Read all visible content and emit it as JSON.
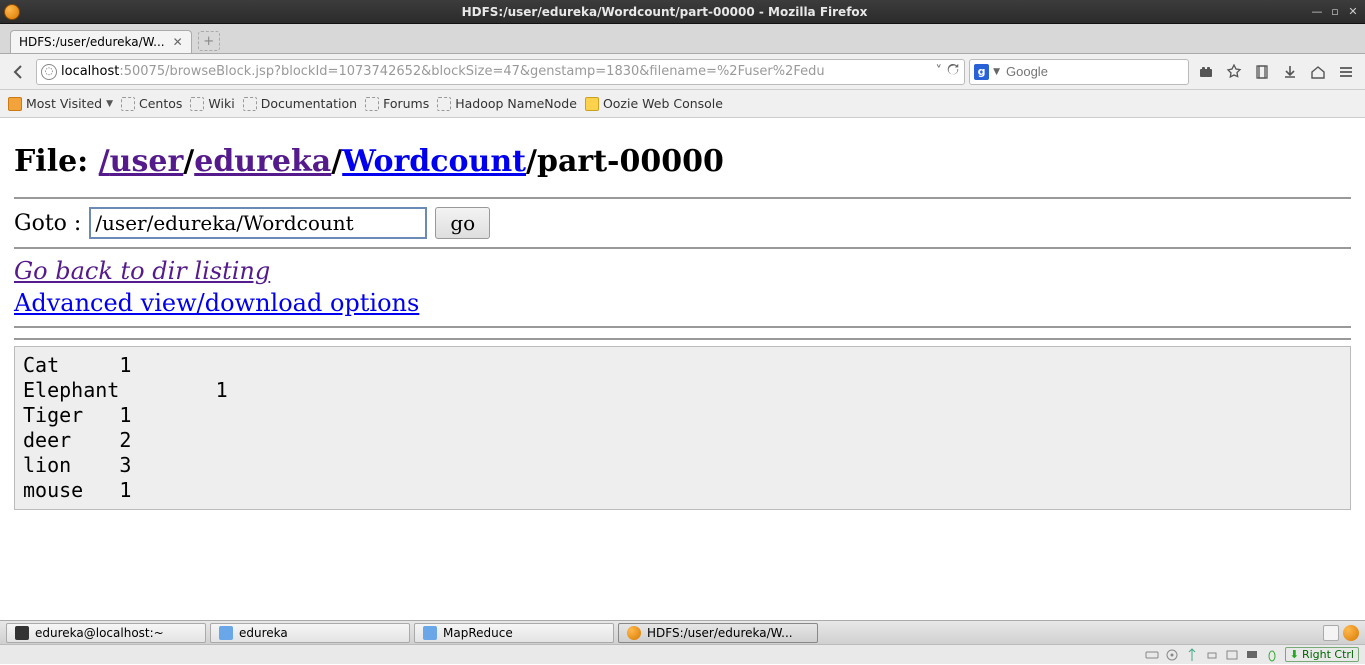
{
  "window": {
    "title": "HDFS:/user/edureka/Wordcount/part-00000 - Mozilla Firefox"
  },
  "tab": {
    "label": "HDFS:/user/edureka/W..."
  },
  "url": {
    "host": "localhost",
    "path": ":50075/browseBlock.jsp?blockId=1073742652&blockSize=47&genstamp=1830&filename=%2Fuser%2Fedu"
  },
  "search": {
    "placeholder": "Google"
  },
  "bookmarks": {
    "most_visited": "Most Visited",
    "items": [
      "Centos",
      "Wiki",
      "Documentation",
      "Forums",
      "Hadoop NameNode",
      "Oozie Web Console"
    ]
  },
  "page": {
    "heading_prefix": "File: ",
    "path_segments": [
      "user",
      "edureka",
      "Wordcount"
    ],
    "file_name": "part-00000",
    "goto_label": "Goto : ",
    "goto_value": "/user/edureka/Wordcount",
    "go_button": "go",
    "back_link": "Go back to dir listing",
    "advanced_link": "Advanced view/download options",
    "file_contents": "Cat     1\nElephant        1\nTiger   1\ndeer    2\nlion    3\nmouse   1"
  },
  "taskbar": {
    "items": [
      {
        "label": "edureka@localhost:~",
        "icon": "term"
      },
      {
        "label": "edureka",
        "icon": "folder"
      },
      {
        "label": "MapReduce",
        "icon": "folder"
      },
      {
        "label": "HDFS:/user/edureka/W...",
        "icon": "ff",
        "active": true
      }
    ]
  },
  "vm": {
    "host_key": "Right Ctrl"
  }
}
